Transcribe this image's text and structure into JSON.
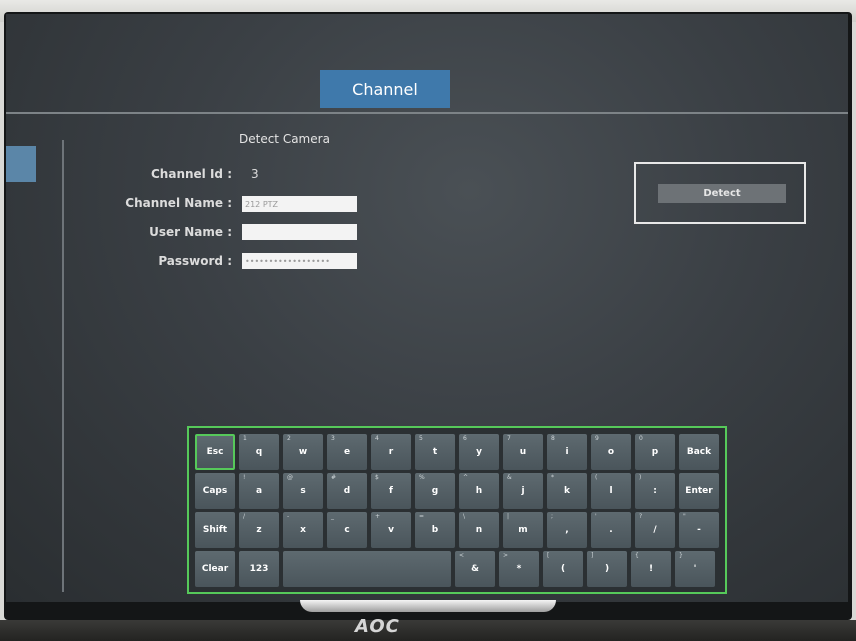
{
  "header": {
    "title": "Channel"
  },
  "section": {
    "title": "Detect Camera"
  },
  "form": {
    "channel_id_label": "Channel Id :",
    "channel_id_value": "3",
    "channel_name_label": "Channel Name :",
    "channel_name_value": "212 PTZ",
    "user_name_label": "User Name :",
    "user_name_value": "",
    "password_label": "Password :",
    "password_value": "••••••••••••••••••"
  },
  "detect": {
    "label": "Detect"
  },
  "keyboard": {
    "rows": [
      [
        {
          "label": "Esc",
          "sub": "",
          "active": true
        },
        {
          "label": "q",
          "sub": "1"
        },
        {
          "label": "w",
          "sub": "2"
        },
        {
          "label": "e",
          "sub": "3"
        },
        {
          "label": "r",
          "sub": "4"
        },
        {
          "label": "t",
          "sub": "5"
        },
        {
          "label": "y",
          "sub": "6"
        },
        {
          "label": "u",
          "sub": "7"
        },
        {
          "label": "i",
          "sub": "8"
        },
        {
          "label": "o",
          "sub": "9"
        },
        {
          "label": "p",
          "sub": "0"
        },
        {
          "label": "Back",
          "sub": ""
        }
      ],
      [
        {
          "label": "Caps",
          "sub": ""
        },
        {
          "label": "a",
          "sub": "!"
        },
        {
          "label": "s",
          "sub": "@"
        },
        {
          "label": "d",
          "sub": "#"
        },
        {
          "label": "f",
          "sub": "$"
        },
        {
          "label": "g",
          "sub": "%"
        },
        {
          "label": "h",
          "sub": "^"
        },
        {
          "label": "j",
          "sub": "&"
        },
        {
          "label": "k",
          "sub": "*"
        },
        {
          "label": "l",
          "sub": "("
        },
        {
          "label": ":",
          "sub": ")"
        },
        {
          "label": "Enter",
          "sub": ""
        }
      ],
      [
        {
          "label": "Shift",
          "sub": ""
        },
        {
          "label": "z",
          "sub": "/"
        },
        {
          "label": "x",
          "sub": "-"
        },
        {
          "label": "c",
          "sub": "_"
        },
        {
          "label": "v",
          "sub": "+"
        },
        {
          "label": "b",
          "sub": "="
        },
        {
          "label": "n",
          "sub": "\\"
        },
        {
          "label": "m",
          "sub": "|"
        },
        {
          "label": ",",
          "sub": ";"
        },
        {
          "label": ".",
          "sub": "'"
        },
        {
          "label": "/",
          "sub": "?"
        },
        {
          "label": "-",
          "sub": "\""
        }
      ],
      [
        {
          "label": "Clear",
          "sub": ""
        },
        {
          "label": "123",
          "sub": ""
        },
        {
          "label": "",
          "sub": "",
          "space": true
        },
        {
          "label": "&",
          "sub": "<"
        },
        {
          "label": "*",
          "sub": ">"
        },
        {
          "label": "(",
          "sub": "["
        },
        {
          "label": ")",
          "sub": "]"
        },
        {
          "label": "!",
          "sub": "{"
        },
        {
          "label": "'",
          "sub": "}"
        }
      ]
    ]
  },
  "monitor": {
    "brand": "AOC"
  }
}
